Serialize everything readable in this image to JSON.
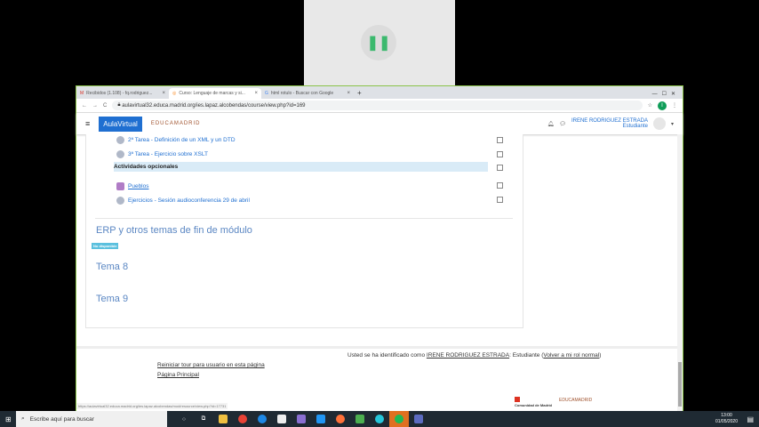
{
  "browser": {
    "tabs": [
      {
        "label": "Recibidos (1.108) - fq.rodriguez...",
        "icon": "gmail-icon"
      },
      {
        "label": "Curso: Lenguaje de marcas y si...",
        "icon": "moodle-icon"
      },
      {
        "label": "html rotulo - Buscar con Google",
        "icon": "google-icon"
      }
    ],
    "new_tab": "+",
    "url": "aulavirtual32.educa.madrid.org/ies.lapaz.alcobendas/course/view.php?id=169",
    "profile_initial": "I",
    "status_url": "https://aulavirtual32.educa.madrid.org/ies.lapaz.alcobendas/mod/resource/view.php?id=17731"
  },
  "header": {
    "logo": "AulaVirtual",
    "brand": "EDUCAMADRID",
    "user_name": "IRENE RODRIGUEZ ESTRADA",
    "user_role": "Estudiante"
  },
  "activities": [
    {
      "label": "2ª Tarea - Definición de un XML y un DTD",
      "type": "assignment"
    },
    {
      "label": "3ª Tarea - Ejercicio sobre XSLT",
      "type": "assignment"
    },
    {
      "label": "Actividades opcionales",
      "type": "label"
    },
    {
      "label": "Pueblos",
      "type": "resource"
    },
    {
      "label": "Ejercicios - Sesión audioconferencia 29 de abril",
      "type": "assignment"
    }
  ],
  "sections": [
    {
      "title": "ERP y otros temas de fin de módulo",
      "badge": "No disponible"
    },
    {
      "title": "Tema 8"
    },
    {
      "title": "Tema 9"
    }
  ],
  "footer": {
    "logged_in_prefix": "Usted se ha identificado como",
    "logged_in_user": "IRENE RODRIGUEZ ESTRADA",
    "logged_in_role": ": Estudiante (",
    "return_role": "Volver a mi rol normal",
    "close_paren": ")",
    "reset_tour": "Reiniciar tour para usuario en esta página",
    "home": "Página Principal",
    "logo1": "Comunidad de Madrid",
    "logo2": "EDUCAMADRID"
  },
  "taskbar": {
    "search_placeholder": "Escribe aquí para buscar",
    "time": "13:00",
    "date": "01/05/2020"
  }
}
